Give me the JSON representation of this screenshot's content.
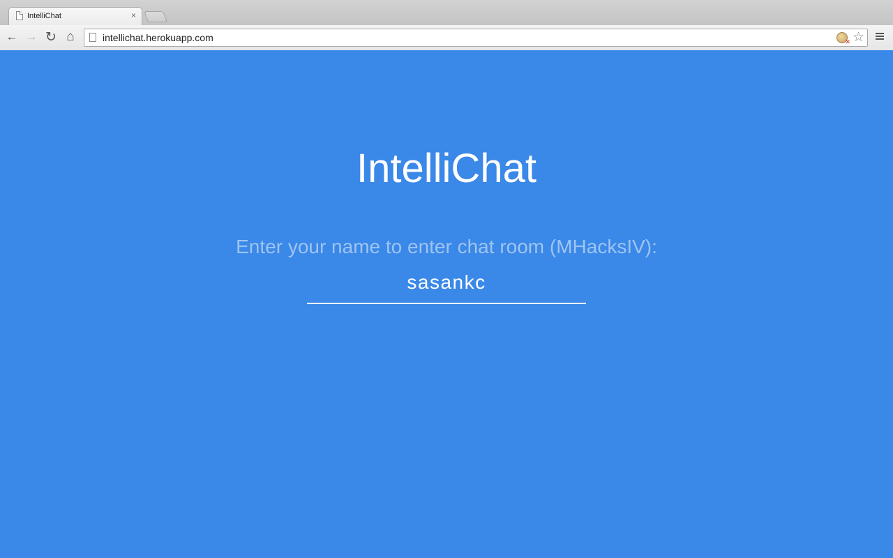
{
  "browser": {
    "tab": {
      "title": "IntelliChat",
      "close_glyph": "×"
    },
    "nav": {
      "back_glyph": "←",
      "forward_glyph": "→",
      "reload_glyph": "↻",
      "home_glyph": "⌂"
    },
    "address_bar": {
      "url": "intellichat.herokuapp.com"
    },
    "star_glyph": "☆"
  },
  "page": {
    "title": "IntelliChat",
    "prompt": "Enter your name to enter chat room (MHacksIV):",
    "name_input": {
      "value": "sasankc"
    }
  },
  "colors": {
    "page_background": "#3a88e8",
    "text_primary": "#ffffff",
    "text_prompt": "#9ec4f2"
  }
}
